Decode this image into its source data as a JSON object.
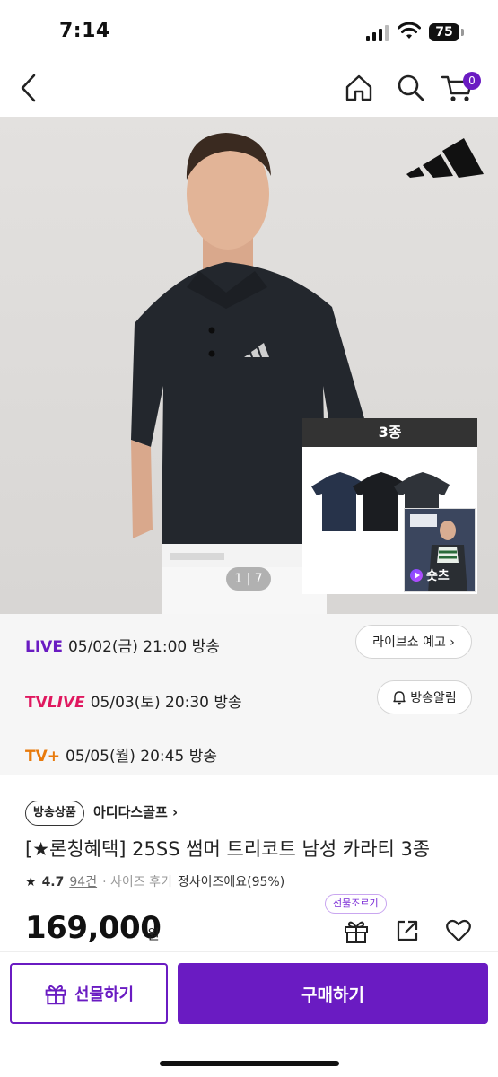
{
  "status_bar": {
    "time": "7:14",
    "battery": "75"
  },
  "nav": {
    "cart_count": "0"
  },
  "hero": {
    "image_counter": "1 | 7",
    "variant_label": "3종",
    "shorts_label": "숏츠"
  },
  "schedule": [
    {
      "channel": "LIVE",
      "text": "05/02(금) 21:00 방송",
      "color": "#6a1bc2"
    },
    {
      "channel_prefix": "TV",
      "channel_suffix": "LIVE",
      "text": "05/03(토) 20:30 방송",
      "color": "#e0185f"
    },
    {
      "channel": "TV+",
      "text": "05/05(월) 20:45 방송",
      "color": "#e87a0c"
    }
  ],
  "buttons": {
    "live_preview": "라이브쇼 예고 ›",
    "alarm": "방송알림"
  },
  "product": {
    "badge": "방송상품",
    "brand": "아디다스골프 ›",
    "title": "[★론칭혜택] 25SS 썸머 트리코트 남성 카라티 3종",
    "rating_star": "★",
    "rating": "4.7",
    "review_count": "94건",
    "size_review_label": "· 사이즈 후기",
    "size_review_value": "정사이즈에요(95%)",
    "price": "169,000",
    "price_unit": "원",
    "gift_tooltip": "선물조르기"
  },
  "bottom": {
    "gift_label": "선물하기",
    "buy_label": "구매하기"
  },
  "colors": {
    "accent": "#6a1bc2",
    "tvlive": "#e0185f",
    "tvplus": "#e87a0c"
  }
}
